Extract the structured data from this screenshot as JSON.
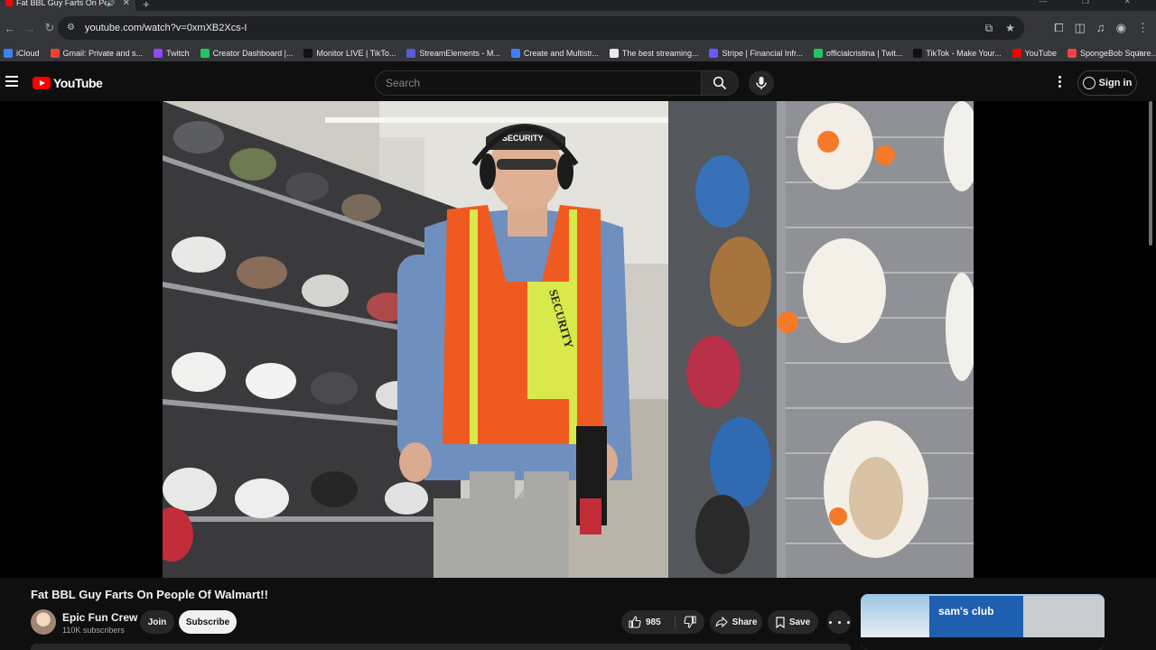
{
  "browser": {
    "tab_title": "Fat BBL Guy Farts On People",
    "url": "youtube.com/watch?v=0xmXB2Xcs-I",
    "bookmarks": [
      {
        "label": "iCloud",
        "color": "#3b82f6"
      },
      {
        "label": "Gmail: Private and s...",
        "color": "#ea4335"
      },
      {
        "label": "Twitch",
        "color": "#9146ff"
      },
      {
        "label": "Creator Dashboard |...",
        "color": "#22c55e"
      },
      {
        "label": "Monitor LIVE | TikTo...",
        "color": "#111111"
      },
      {
        "label": "StreamElements - M...",
        "color": "#5b5bd6"
      },
      {
        "label": "Create and Multistr...",
        "color": "#3b82f6"
      },
      {
        "label": "The best streaming...",
        "color": "#e8eaed"
      },
      {
        "label": "Stripe | Financial Infr...",
        "color": "#635bff"
      },
      {
        "label": "officialcristina | Twit...",
        "color": "#22c55e"
      },
      {
        "label": "TikTok - Make Your...",
        "color": "#111111"
      },
      {
        "label": "YouTube",
        "color": "#ff0000"
      },
      {
        "label": "SpongeBob Square...",
        "color": "#ef4444"
      }
    ]
  },
  "masthead": {
    "logo_text": "YouTube",
    "search_placeholder": "Search",
    "signin_label": "Sign in"
  },
  "video": {
    "title": "Fat BBL Guy Farts On People Of Walmart!!",
    "vest_text": "SECURITY",
    "cap_text": "SECURITY"
  },
  "channel": {
    "name": "Epic Fun Crew",
    "subscribers": "110K subscribers",
    "join_label": "Join",
    "subscribe_label": "Subscribe"
  },
  "actions": {
    "likes": "985",
    "share_label": "Share",
    "save_label": "Save"
  },
  "ad": {
    "logo": "sam's club"
  },
  "colors": {
    "brand_red": "#ff0000",
    "background": "#0f0f0f",
    "pill": "#272727"
  }
}
